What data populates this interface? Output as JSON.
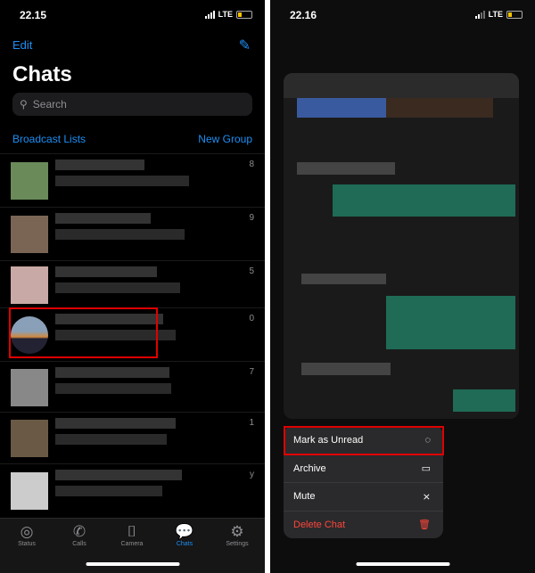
{
  "left": {
    "time": "22.15",
    "network": "LTE",
    "edit": "Edit",
    "title": "Chats",
    "search_placeholder": "Search",
    "broadcast": "Broadcast Lists",
    "new_group": "New Group",
    "rows": [
      {
        "num": "8"
      },
      {
        "num": "9"
      },
      {
        "num": "5"
      },
      {
        "num": "0"
      },
      {
        "num": "7"
      },
      {
        "num": "1"
      },
      {
        "num": "y"
      }
    ],
    "tabs": [
      {
        "label": "Status",
        "icon": "status-icon"
      },
      {
        "label": "Calls",
        "icon": "phone-icon"
      },
      {
        "label": "Camera",
        "icon": "camera-icon"
      },
      {
        "label": "Chats",
        "icon": "chats-icon"
      },
      {
        "label": "Settings",
        "icon": "gear-icon"
      }
    ],
    "active_tab": "Chats"
  },
  "right": {
    "time": "22.16",
    "network": "LTE",
    "menu": [
      {
        "label": "Mark as Unread",
        "icon": "unread-icon"
      },
      {
        "label": "Archive",
        "icon": "archive-icon"
      },
      {
        "label": "Mute",
        "icon": "mute-icon"
      },
      {
        "label": "Delete Chat",
        "icon": "trash-icon"
      }
    ]
  },
  "colors": {
    "accent": "#1d8ff5",
    "highlight": "#e00000",
    "destructive": "#ff453a",
    "battery": "#f5c400"
  }
}
